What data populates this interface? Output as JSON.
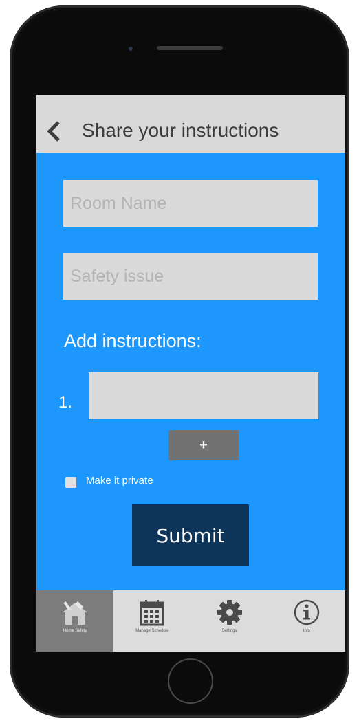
{
  "header": {
    "title": "Share your instructions"
  },
  "form": {
    "room_placeholder": "Room Name",
    "safety_placeholder": "Safety issue",
    "add_label": "Add instructions:",
    "step_number": "1.",
    "add_step_label": "+",
    "private_label": "Make it private",
    "private_checked": false,
    "submit_label": "Submit"
  },
  "tabs": [
    {
      "label": "Home Safety",
      "icon": "home-tools-icon",
      "active": true
    },
    {
      "label": "Manage Schedule",
      "icon": "calendar-icon",
      "active": false
    },
    {
      "label": "Settings",
      "icon": "gear-icon",
      "active": false
    },
    {
      "label": "Info",
      "icon": "info-icon",
      "active": false
    }
  ],
  "colors": {
    "screen_bg": "#1d97fb",
    "header_bg": "#d9d9d9",
    "submit_bg": "#0e3559",
    "active_tab_bg": "#7c7c7c"
  }
}
